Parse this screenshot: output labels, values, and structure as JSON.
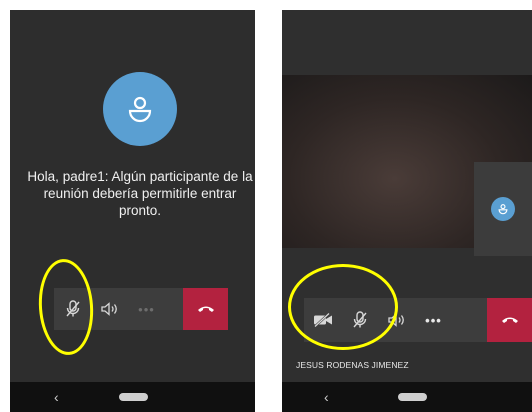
{
  "left_screen": {
    "lobby_message": "Hola, padre1: Algún participante de la reunión debería permitirle entrar pronto.",
    "avatar_color": "#5a9fd2",
    "toolbar": {
      "mute_icon": "mic-off-icon",
      "speaker_icon": "speaker-icon",
      "more_icon": "more-dots-icon",
      "more_label": "•••",
      "end_icon": "hang-up-icon",
      "end_color": "#b3223f"
    },
    "nav": {
      "back_label": "‹"
    }
  },
  "right_screen": {
    "participant_name": "JESUS RODENAS JIMENEZ",
    "toolbar": {
      "camera_icon": "camera-off-icon",
      "mute_icon": "mic-off-icon",
      "speaker_icon": "speaker-icon",
      "more_icon": "more-dots-icon",
      "more_label": "•••",
      "end_icon": "hang-up-icon",
      "end_color": "#b3223f"
    },
    "nav": {
      "back_label": "‹"
    }
  },
  "annotation_color": "#ffff00"
}
